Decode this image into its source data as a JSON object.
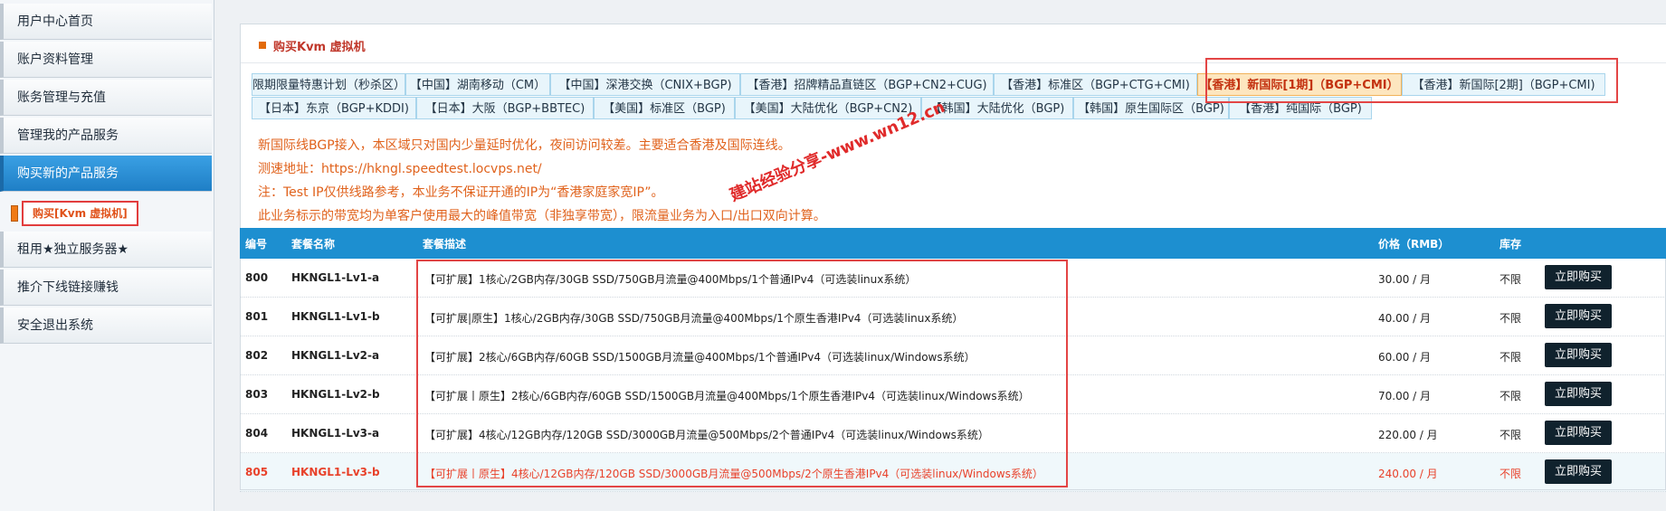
{
  "sidebar": {
    "items": [
      {
        "label": "用户中心首页"
      },
      {
        "label": "账户资料管理"
      },
      {
        "label": "账务管理与充值"
      },
      {
        "label": "管理我的产品服务"
      },
      {
        "label": "购买新的产品服务"
      },
      {
        "label": "租用★独立服务器★"
      },
      {
        "label": "推介下线链接赚钱"
      },
      {
        "label": "安全退出系统"
      }
    ],
    "active_index": 4,
    "sub_item": "购买[Kvm 虚拟机]"
  },
  "panel": {
    "title": "购买Kvm 虚拟机"
  },
  "tabs": [
    {
      "label": "限期限量特惠计划（秒杀区）"
    },
    {
      "label": "【中国】湖南移动（CM）"
    },
    {
      "label": "【中国】深港交换（CNIX+BGP)"
    },
    {
      "label": "【香港】招牌精品直链区（BGP+CN2+CUG)"
    },
    {
      "label": "【香港】标准区（BGP+CTG+CMI)"
    },
    {
      "label": "【香港】新国际[1期]（BGP+CMI）"
    },
    {
      "label": "【香港】新国际[2期]（BGP+CMI)"
    },
    {
      "label": "【日本】东京（BGP+KDDI)"
    },
    {
      "label": "【日本】大阪（BGP+BBTEC)"
    },
    {
      "label": "【美国】标准区（BGP)"
    },
    {
      "label": "【美国】大陆优化（BGP+CN2)"
    },
    {
      "label": "【韩国】大陆优化（BGP)"
    },
    {
      "label": "【韩国】原生国际区（BGP)"
    },
    {
      "label": "【香港】纯国际（BGP)"
    }
  ],
  "active_tab": 5,
  "notices": [
    "新国际线BGP接入，本区域只对国内少量延时优化，夜间访问较差。主要适合香港及国际连线。",
    "测速地址：https://hkngl.speedtest.locvps.net/",
    "注：Test IP仅供线路参考，本业务不保证开通的IP为“香港家庭家宽IP”。",
    "此业务标示的带宽均为单客户使用最大的峰值带宽（非独享带宽），限流量业务为入口/出口双向计算。"
  ],
  "watermark": "建站经验分享-www.wn12.cn",
  "table": {
    "headers": {
      "id": "编号",
      "name": "套餐名称",
      "desc": "套餐描述",
      "price": "价格（RMB）",
      "stock": "库存"
    },
    "buy_label": "立即购买",
    "rows": [
      {
        "id": "800",
        "name": "HKNGL1-Lv1-a",
        "desc": "【可扩展】1核心/2GB内存/30GB SSD/750GB月流量@400Mbps/1个普通IPv4（可选装linux系统）",
        "price": "30.00 / 月",
        "stock": "不限"
      },
      {
        "id": "801",
        "name": "HKNGL1-Lv1-b",
        "desc": "【可扩展|原生】1核心/2GB内存/30GB SSD/750GB月流量@400Mbps/1个原生香港IPv4（可选装linux系统）",
        "price": "40.00 / 月",
        "stock": "不限"
      },
      {
        "id": "802",
        "name": "HKNGL1-Lv2-a",
        "desc": "【可扩展】2核心/6GB内存/60GB SSD/1500GB月流量@400Mbps/1个普通IPv4（可选装linux/Windows系统）",
        "price": "60.00 / 月",
        "stock": "不限"
      },
      {
        "id": "803",
        "name": "HKNGL1-Lv2-b",
        "desc": "【可扩展丨原生】2核心/6GB内存/60GB SSD/1500GB月流量@400Mbps/1个原生香港IPv4（可选装linux/Windows系统）",
        "price": "70.00 / 月",
        "stock": "不限"
      },
      {
        "id": "804",
        "name": "HKNGL1-Lv3-a",
        "desc": "【可扩展】4核心/12GB内存/120GB SSD/3000GB月流量@500Mbps/2个普通IPv4（可选装linux/Windows系统）",
        "price": "220.00 / 月",
        "stock": "不限"
      },
      {
        "id": "805",
        "name": "HKNGL1-Lv3-b",
        "desc": "【可扩展丨原生】4核心/12GB内存/120GB SSD/3000GB月流量@500Mbps/2个原生香港IPv4（可选装linux/Windows系统）",
        "price": "240.00 / 月",
        "stock": "不限"
      }
    ]
  },
  "colors": {
    "accent": "#1d8fd0",
    "highlight_red": "#e34545",
    "notice_orange": "#e0621c",
    "button_dark": "#10222d"
  }
}
